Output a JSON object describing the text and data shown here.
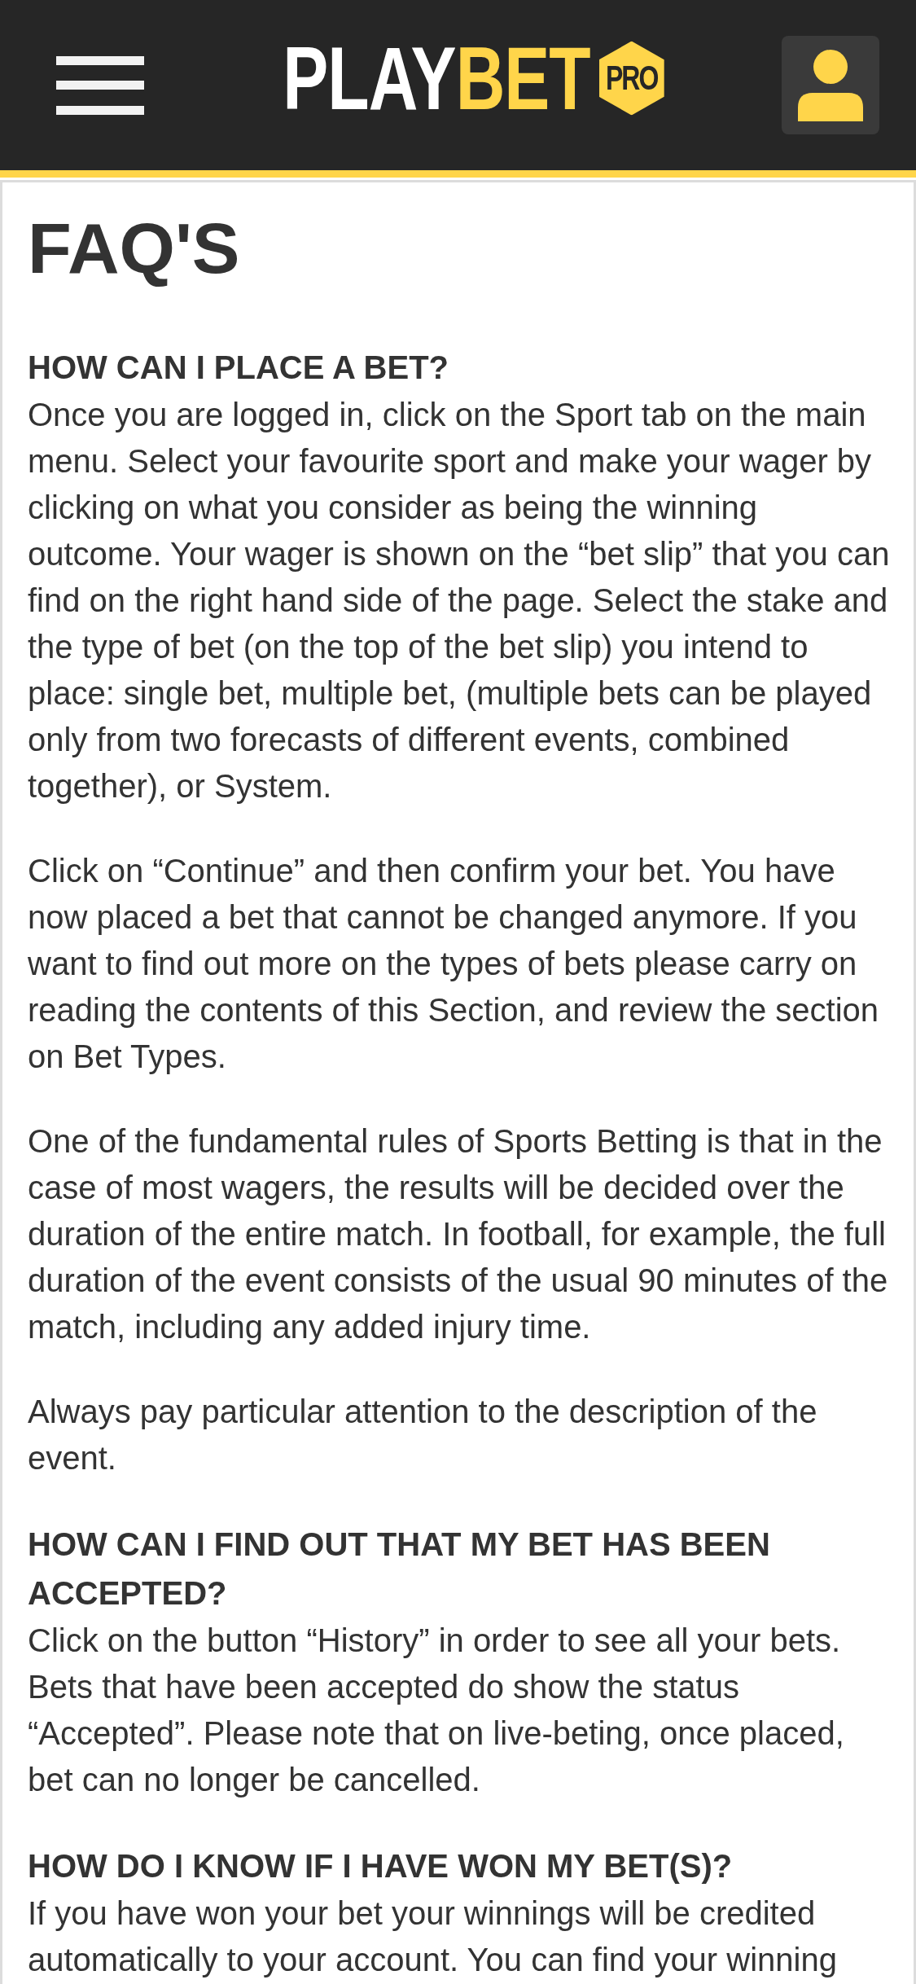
{
  "header": {
    "logo": {
      "first_part": "PLAY",
      "second_part": "BET",
      "badge": "PRO"
    }
  },
  "page": {
    "title": "FAQ'S",
    "sections": [
      {
        "question": "HOW CAN I PLACE A BET?",
        "paragraphs": [
          "Once you are logged in, click on the Sport tab on the main menu. Select your favourite sport and make your wager by clicking on what you consider as being the winning outcome. Your wager is shown on the “bet slip” that you can find on the right hand side of the page. Select the stake and the type of bet (on the top of the bet slip) you intend to place: single bet, multiple bet, (multiple bets can be played only from two forecasts of different events, combined together), or System.",
          "Click on “Continue” and then confirm your bet. You have now placed a bet that cannot be changed anymore. If you want to find out more on the types of bets please carry on reading the contents of this Section, and review the section on Bet Types.",
          "One of the fundamental rules of Sports Betting is that in the case of most wagers, the results will be decided over the duration of the entire match. In football, for example, the full duration of the event consists of the usual 90 minutes of the match, including any added injury time.",
          "Always pay particular attention to the description of the event."
        ]
      },
      {
        "question": "HOW CAN I FIND OUT THAT MY BET HAS BEEN ACCEPTED?",
        "paragraphs": [
          "Click on the button “History” in order to see all your bets. Bets that have been accepted do show the status “Accepted”. Please note that on live-beting, once placed, bet can no longer be cancelled."
        ]
      },
      {
        "question": "HOW DO I KNOW IF I HAVE WON MY BET(S)?",
        "paragraphs": [
          "If you have won your bet your winnings will be credited automatically to your account. You can find your winning"
        ]
      }
    ]
  }
}
